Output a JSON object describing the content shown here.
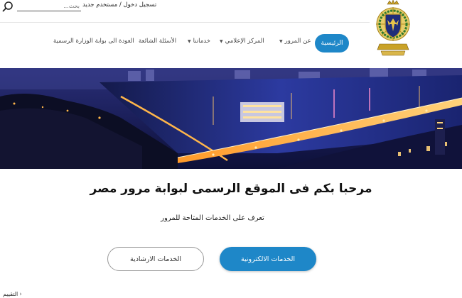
{
  "header": {
    "search": {
      "placeholder": "بحث...",
      "value": ""
    },
    "auth": {
      "login": "تسجيل دخول",
      "separator": " / ",
      "register": "مستخدم جديد"
    }
  },
  "nav": {
    "items": [
      {
        "label": "الرئيسية",
        "active": true,
        "has_dropdown": false
      },
      {
        "label": "عن المرور",
        "active": false,
        "has_dropdown": true
      },
      {
        "label": "المركز الإعلامي",
        "active": false,
        "has_dropdown": true
      },
      {
        "label": "خدماتنا",
        "active": false,
        "has_dropdown": true
      },
      {
        "label": "الأسئلة الشائعة",
        "active": false,
        "has_dropdown": false
      },
      {
        "label": "العودة الى بوابة الوزارة الرسمية",
        "active": false,
        "has_dropdown": false
      }
    ]
  },
  "hero": {
    "image_alt": ""
  },
  "welcome": {
    "title": "مرحبا بكم فى الموقع الرسمى لبوابة مرور مصر",
    "subtitle": "تعرف على الخدمات المتاحة للمرور"
  },
  "buttons": {
    "electronic": "الخدمات الالكترونية",
    "guidance": "الخدمات الارشادية"
  },
  "breadcrumb": {
    "label": "التقييم"
  },
  "colors": {
    "primary": "#1e87c8",
    "hero_sky": "#1b1f5a",
    "river": "#1d2a7a",
    "bridge_light": "#ffb64a"
  },
  "icons": {
    "search": "search-icon",
    "logo": "police-emblem-logo",
    "caret": "caret-down-icon",
    "breadcrumb": "chevron-left-icon"
  }
}
